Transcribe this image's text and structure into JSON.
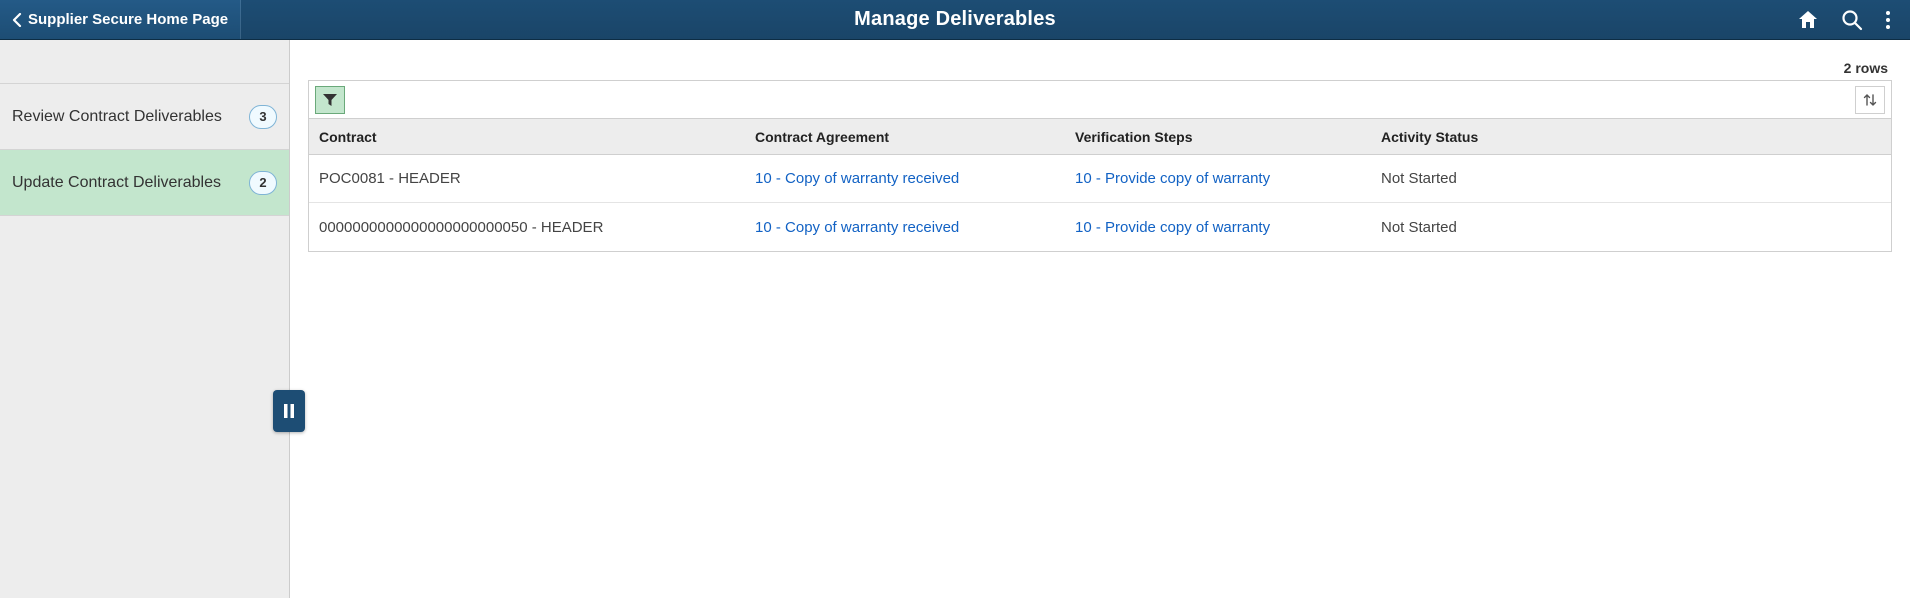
{
  "header": {
    "back_label": "Supplier Secure Home Page",
    "title": "Manage Deliverables"
  },
  "sidebar": {
    "items": [
      {
        "label": "Review Contract Deliverables",
        "count": "3",
        "selected": false
      },
      {
        "label": "Update Contract Deliverables",
        "count": "2",
        "selected": true
      }
    ]
  },
  "grid": {
    "row_count_text": "2 rows",
    "columns": {
      "contract": "Contract",
      "agreement": "Contract Agreement",
      "verification": "Verification Steps",
      "status": "Activity Status"
    },
    "rows": [
      {
        "contract": "POC0081 - HEADER",
        "agreement": "10 - Copy of warranty received",
        "verification": "10 - Provide copy of warranty",
        "status": "Not Started"
      },
      {
        "contract": "0000000000000000000000050 - HEADER",
        "agreement": "10 - Copy of warranty received",
        "verification": "10 - Provide copy of warranty",
        "status": "Not Started"
      }
    ]
  }
}
